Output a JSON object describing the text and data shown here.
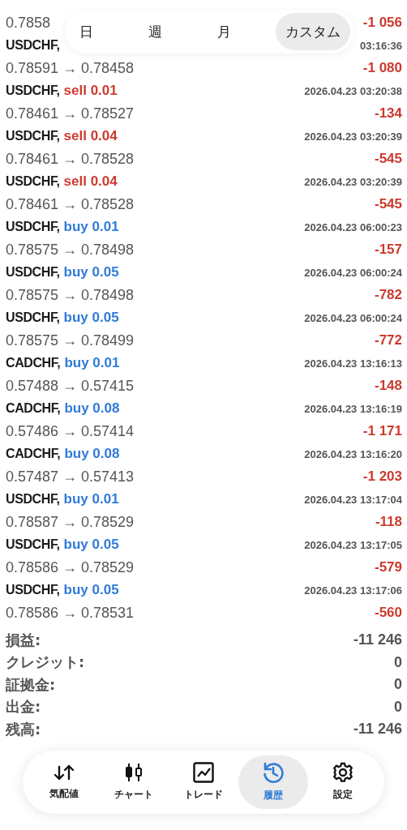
{
  "period_tabs": [
    {
      "label": "日",
      "selected": false
    },
    {
      "label": "週",
      "selected": false
    },
    {
      "label": "月",
      "selected": false
    },
    {
      "label": "カスタム",
      "selected": true
    }
  ],
  "deals": [
    {
      "prices": "0.7858",
      "profit": "-1 056"
    },
    {
      "symbol": "USDCHF,",
      "time": "03:16:36",
      "prices": "0.78591 → 0.78458",
      "profit": "-1 080"
    },
    {
      "symbol": "USDCHF,",
      "kind": "sell",
      "order": "sell 0.01",
      "time": "2026.04.23 03:20:38",
      "prices": "0.78461 → 0.78527",
      "profit": "-134"
    },
    {
      "symbol": "USDCHF,",
      "kind": "sell",
      "order": "sell 0.04",
      "time": "2026.04.23 03:20:39",
      "prices": "0.78461 → 0.78528",
      "profit": "-545"
    },
    {
      "symbol": "USDCHF,",
      "kind": "sell",
      "order": "sell 0.04",
      "time": "2026.04.23 03:20:39",
      "prices": "0.78461 → 0.78528",
      "profit": "-545"
    },
    {
      "symbol": "USDCHF,",
      "kind": "buy",
      "order": "buy 0.01",
      "time": "2026.04.23 06:00:23",
      "prices": "0.78575 → 0.78498",
      "profit": "-157"
    },
    {
      "symbol": "USDCHF,",
      "kind": "buy",
      "order": "buy 0.05",
      "time": "2026.04.23 06:00:24",
      "prices": "0.78575 → 0.78498",
      "profit": "-782"
    },
    {
      "symbol": "USDCHF,",
      "kind": "buy",
      "order": "buy 0.05",
      "time": "2026.04.23 06:00:24",
      "prices": "0.78575 → 0.78499",
      "profit": "-772"
    },
    {
      "symbol": "CADCHF,",
      "kind": "buy",
      "order": "buy 0.01",
      "time": "2026.04.23 13:16:13",
      "prices": "0.57488 → 0.57415",
      "profit": "-148"
    },
    {
      "symbol": "CADCHF,",
      "kind": "buy",
      "order": "buy 0.08",
      "time": "2026.04.23 13:16:19",
      "prices": "0.57486 → 0.57414",
      "profit": "-1 171"
    },
    {
      "symbol": "CADCHF,",
      "kind": "buy",
      "order": "buy 0.08",
      "time": "2026.04.23 13:16:20",
      "prices": "0.57487 → 0.57413",
      "profit": "-1 203"
    },
    {
      "symbol": "USDCHF,",
      "kind": "buy",
      "order": "buy 0.01",
      "time": "2026.04.23 13:17:04",
      "prices": "0.78587 → 0.78529",
      "profit": "-118"
    },
    {
      "symbol": "USDCHF,",
      "kind": "buy",
      "order": "buy 0.05",
      "time": "2026.04.23 13:17:05",
      "prices": "0.78586 → 0.78529",
      "profit": "-579"
    },
    {
      "symbol": "USDCHF,",
      "kind": "buy",
      "order": "buy 0.05",
      "time": "2026.04.23 13:17:06",
      "prices": "0.78586 → 0.78531",
      "profit": "-560"
    }
  ],
  "summary": [
    {
      "label": "損益:",
      "value": "-11 246"
    },
    {
      "label": "クレジット:",
      "value": "0"
    },
    {
      "label": "証拠金:",
      "value": "0"
    },
    {
      "label": "出金:",
      "value": "0"
    },
    {
      "label": "残高:",
      "value": "-11 246"
    }
  ],
  "nav": [
    {
      "label": "気配値",
      "selected": false
    },
    {
      "label": "チャート",
      "selected": false
    },
    {
      "label": "トレード",
      "selected": false
    },
    {
      "label": "履歴",
      "selected": true
    },
    {
      "label": "設定",
      "selected": false
    }
  ]
}
